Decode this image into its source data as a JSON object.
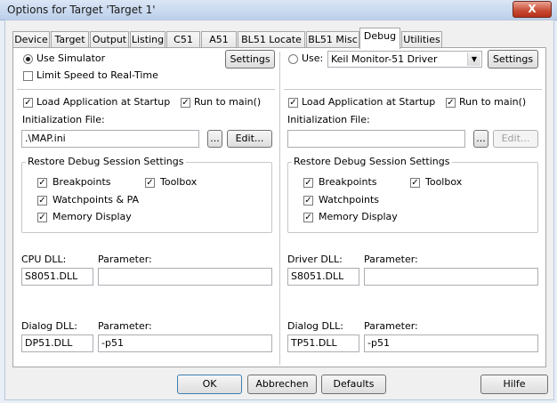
{
  "window": {
    "title": "Options for Target 'Target 1'",
    "close_glyph": "X"
  },
  "tabs": [
    {
      "label": "Device"
    },
    {
      "label": "Target"
    },
    {
      "label": "Output"
    },
    {
      "label": "Listing"
    },
    {
      "label": "C51"
    },
    {
      "label": "A51"
    },
    {
      "label": "BL51 Locate"
    },
    {
      "label": "BL51 Misc"
    },
    {
      "label": "Debug"
    },
    {
      "label": "Utilities"
    }
  ],
  "active_tab": "Debug",
  "left": {
    "mode_label": "Use Simulator",
    "mode_selected": true,
    "settings_label": "Settings",
    "limit_speed_label": "Limit Speed to Real-Time",
    "limit_speed_checked": false,
    "load_app_label": "Load Application at Startup",
    "load_app_checked": true,
    "run_main_label": "Run to main()",
    "run_main_checked": true,
    "init_file_label": "Initialization File:",
    "init_file_value": ".\\MAP.ini",
    "browse_label": "...",
    "edit_label": "Edit...",
    "restore_group_label": "Restore Debug Session Settings",
    "breakpoints_label": "Breakpoints",
    "toolbox_label": "Toolbox",
    "watchpoints_label": "Watchpoints & PA",
    "memory_label": "Memory Display",
    "cpu_dll_label": "CPU DLL:",
    "cpu_dll_value": "S8051.DLL",
    "cpu_param_label": "Parameter:",
    "cpu_param_value": "",
    "dialog_dll_label": "Dialog DLL:",
    "dialog_dll_value": "DP51.DLL",
    "dialog_param_label": "Parameter:",
    "dialog_param_value": "-p51"
  },
  "right": {
    "mode_label": "Use:",
    "mode_selected": false,
    "driver_value": "Keil Monitor-51 Driver",
    "settings_label": "Settings",
    "load_app_label": "Load Application at Startup",
    "load_app_checked": true,
    "run_main_label": "Run to main()",
    "run_main_checked": true,
    "init_file_label": "Initialization File:",
    "init_file_value": "",
    "browse_label": "...",
    "edit_label": "Edit...",
    "restore_group_label": "Restore Debug Session Settings",
    "breakpoints_label": "Breakpoints",
    "toolbox_label": "Toolbox",
    "watchpoints_label": "Watchpoints",
    "memory_label": "Memory Display",
    "driver_dll_label": "Driver DLL:",
    "driver_dll_value": "S8051.DLL",
    "driver_param_label": "Parameter:",
    "driver_param_value": "",
    "dialog_dll_label": "Dialog DLL:",
    "dialog_dll_value": "TP51.DLL",
    "dialog_param_label": "Parameter:",
    "dialog_param_value": "-p51"
  },
  "footer": {
    "ok_label": "OK",
    "cancel_label": "Abbrechen",
    "defaults_label": "Defaults",
    "help_label": "Hilfe"
  },
  "check_glyph": "✓",
  "colors": {
    "close_button": "#c74a32",
    "titlebar": "#bcd0ea",
    "panel_bg": "#ffffff",
    "dialog_bg": "#f0f0f0"
  }
}
